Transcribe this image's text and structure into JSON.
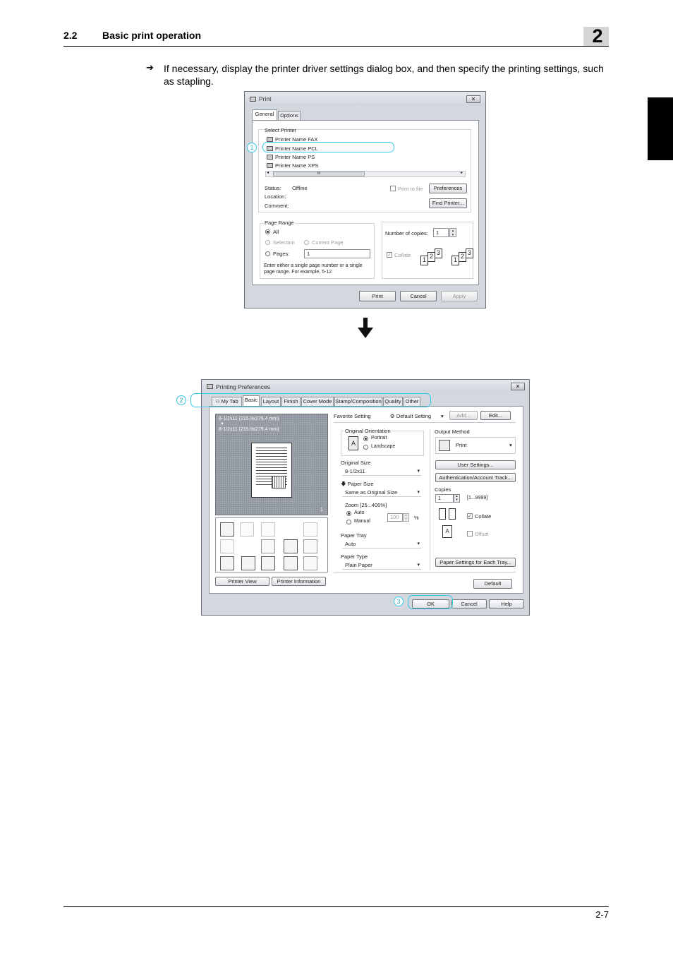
{
  "header": {
    "section_number": "2.2",
    "section_title": "Basic print operation",
    "chapter": "2"
  },
  "instruction": {
    "arrow": "➔",
    "text": "If necessary, display the printer driver settings dialog box, and then specify the printing settings, such as stapling."
  },
  "print_dialog": {
    "title": "Print",
    "close": "✕",
    "tabs": [
      "General",
      "Options"
    ],
    "select_printer_label": "Select Printer",
    "printers": [
      "Printer Name FAX",
      "Printer Name PCL",
      "Printer Name PS",
      "Printer Name XPS"
    ],
    "scroll_mark": "III",
    "status_label": "Status:",
    "status_value": "Offline",
    "location_label": "Location:",
    "comment_label": "Comment:",
    "print_to_file": "Print to file",
    "preferences_button": "Preferences",
    "find_printer_button": "Find Printer...",
    "page_range_label": "Page Range",
    "all": "All",
    "selection": "Selection",
    "current_page": "Current Page",
    "pages": "Pages:",
    "pages_value": "1",
    "hint": "Enter either a single page number or a single page range.  For example, 5-12",
    "copies_label": "Number of copies:",
    "copies_value": "1",
    "collate": "Collate",
    "collate_pages": [
      "1",
      "2",
      "3"
    ],
    "print_button": "Print",
    "cancel_button": "Cancel",
    "apply_button": "Apply",
    "callout": "1"
  },
  "down_arrow": "🡇",
  "prefs_dialog": {
    "title": "Printing Preferences",
    "close": "✕",
    "tabs": [
      "My Tab",
      "Basic",
      "Layout",
      "Finish",
      "Cover Mode",
      "Stamp/Composition",
      "Quality",
      "Other"
    ],
    "preview_lines": [
      "8-1/2x11 (215.9x279.4 mm)",
      "▼",
      "8-1/2x11 (215.9x279.4 mm)"
    ],
    "preview_counter": "1",
    "printer_view_button": "Printer View",
    "printer_information_button": "Printer Information",
    "favorite_label": "Favorite Setting",
    "favorite_value": "Default Setting",
    "add_button": "Add...",
    "edit_button": "Edit...",
    "orientation_label": "Original Orientation",
    "portrait": "Portrait",
    "landscape": "Landscape",
    "original_size_label": "Original Size",
    "original_size_value": "8-1/2x11",
    "paper_size_label": "Paper Size",
    "paper_size_value": "Same as Original Size",
    "zoom_label": "Zoom [25...400%]",
    "zoom_auto": "Auto",
    "zoom_manual": "Manual",
    "zoom_value": "100",
    "zoom_unit": "%",
    "paper_tray_label": "Paper Tray",
    "paper_tray_value": "Auto",
    "paper_type_label": "Paper Type",
    "paper_type_value": "Plain Paper",
    "output_method_label": "Output Method",
    "output_method_value": "Print",
    "user_settings_button": "User Settings...",
    "auth_button": "Authentication/Account Track...",
    "copies_label": "Copies",
    "copies_value": "1",
    "copies_range": "[1...9999]",
    "collate": "Collate",
    "offset": "Offset",
    "paper_settings_button": "Paper Settings for Each Tray...",
    "default_button": "Default",
    "ok_button": "OK",
    "cancel_button": "Cancel",
    "help_button": "Help",
    "callouts": [
      "2",
      "3"
    ]
  },
  "footer": {
    "page": "2-7"
  }
}
